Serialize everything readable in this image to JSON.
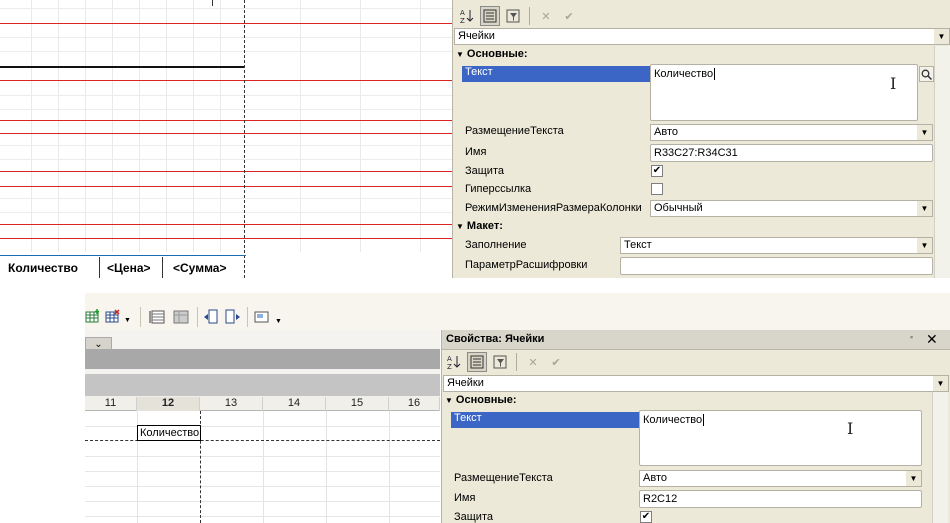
{
  "top": {
    "footer_cells": [
      "Количество",
      "<Цена>",
      "<Сумма>"
    ],
    "toolbar_icons": [
      "sort-az-icon",
      "categories-icon",
      "filter-icon",
      "cancel-icon",
      "apply-icon"
    ],
    "object_combo": "Ячейки",
    "sections": {
      "main": "Основные:",
      "layout": "Макет:"
    },
    "props": {
      "text_label": "Текст",
      "text_value": "Количество",
      "placement_label": "РазмещениеТекста",
      "placement_value": "Авто",
      "name_label": "Имя",
      "name_value": "R33C27:R34C31",
      "protect_label": "Защита",
      "protect_checked": true,
      "hyperlink_label": "Гиперссылка",
      "hyperlink_checked": false,
      "resize_label": "РежимИзмененияРазмераКолонки",
      "resize_value": "Обычный",
      "fill_label": "Заполнение",
      "fill_value": "Текст",
      "decode_label": "ПараметрРасшифровки",
      "decode_value": ""
    }
  },
  "bottom": {
    "panel_title": "Свойства: Ячейки",
    "object_combo": "Ячейки",
    "sections": {
      "main": "Основные:"
    },
    "columns": [
      "11",
      "12",
      "13",
      "14",
      "15",
      "16"
    ],
    "selected_column": "12",
    "cell_text": "Количество",
    "props": {
      "text_label": "Текст",
      "text_value": "Количество",
      "placement_label": "РазмещениеТекста",
      "placement_value": "Авто",
      "name_label": "Имя",
      "name_value": "R2C12",
      "protect_label": "Защита",
      "protect_checked": true
    }
  },
  "colors": {
    "accent": "#3b66c6",
    "panel": "#ece9d8",
    "red_lines": "#dd2222"
  }
}
